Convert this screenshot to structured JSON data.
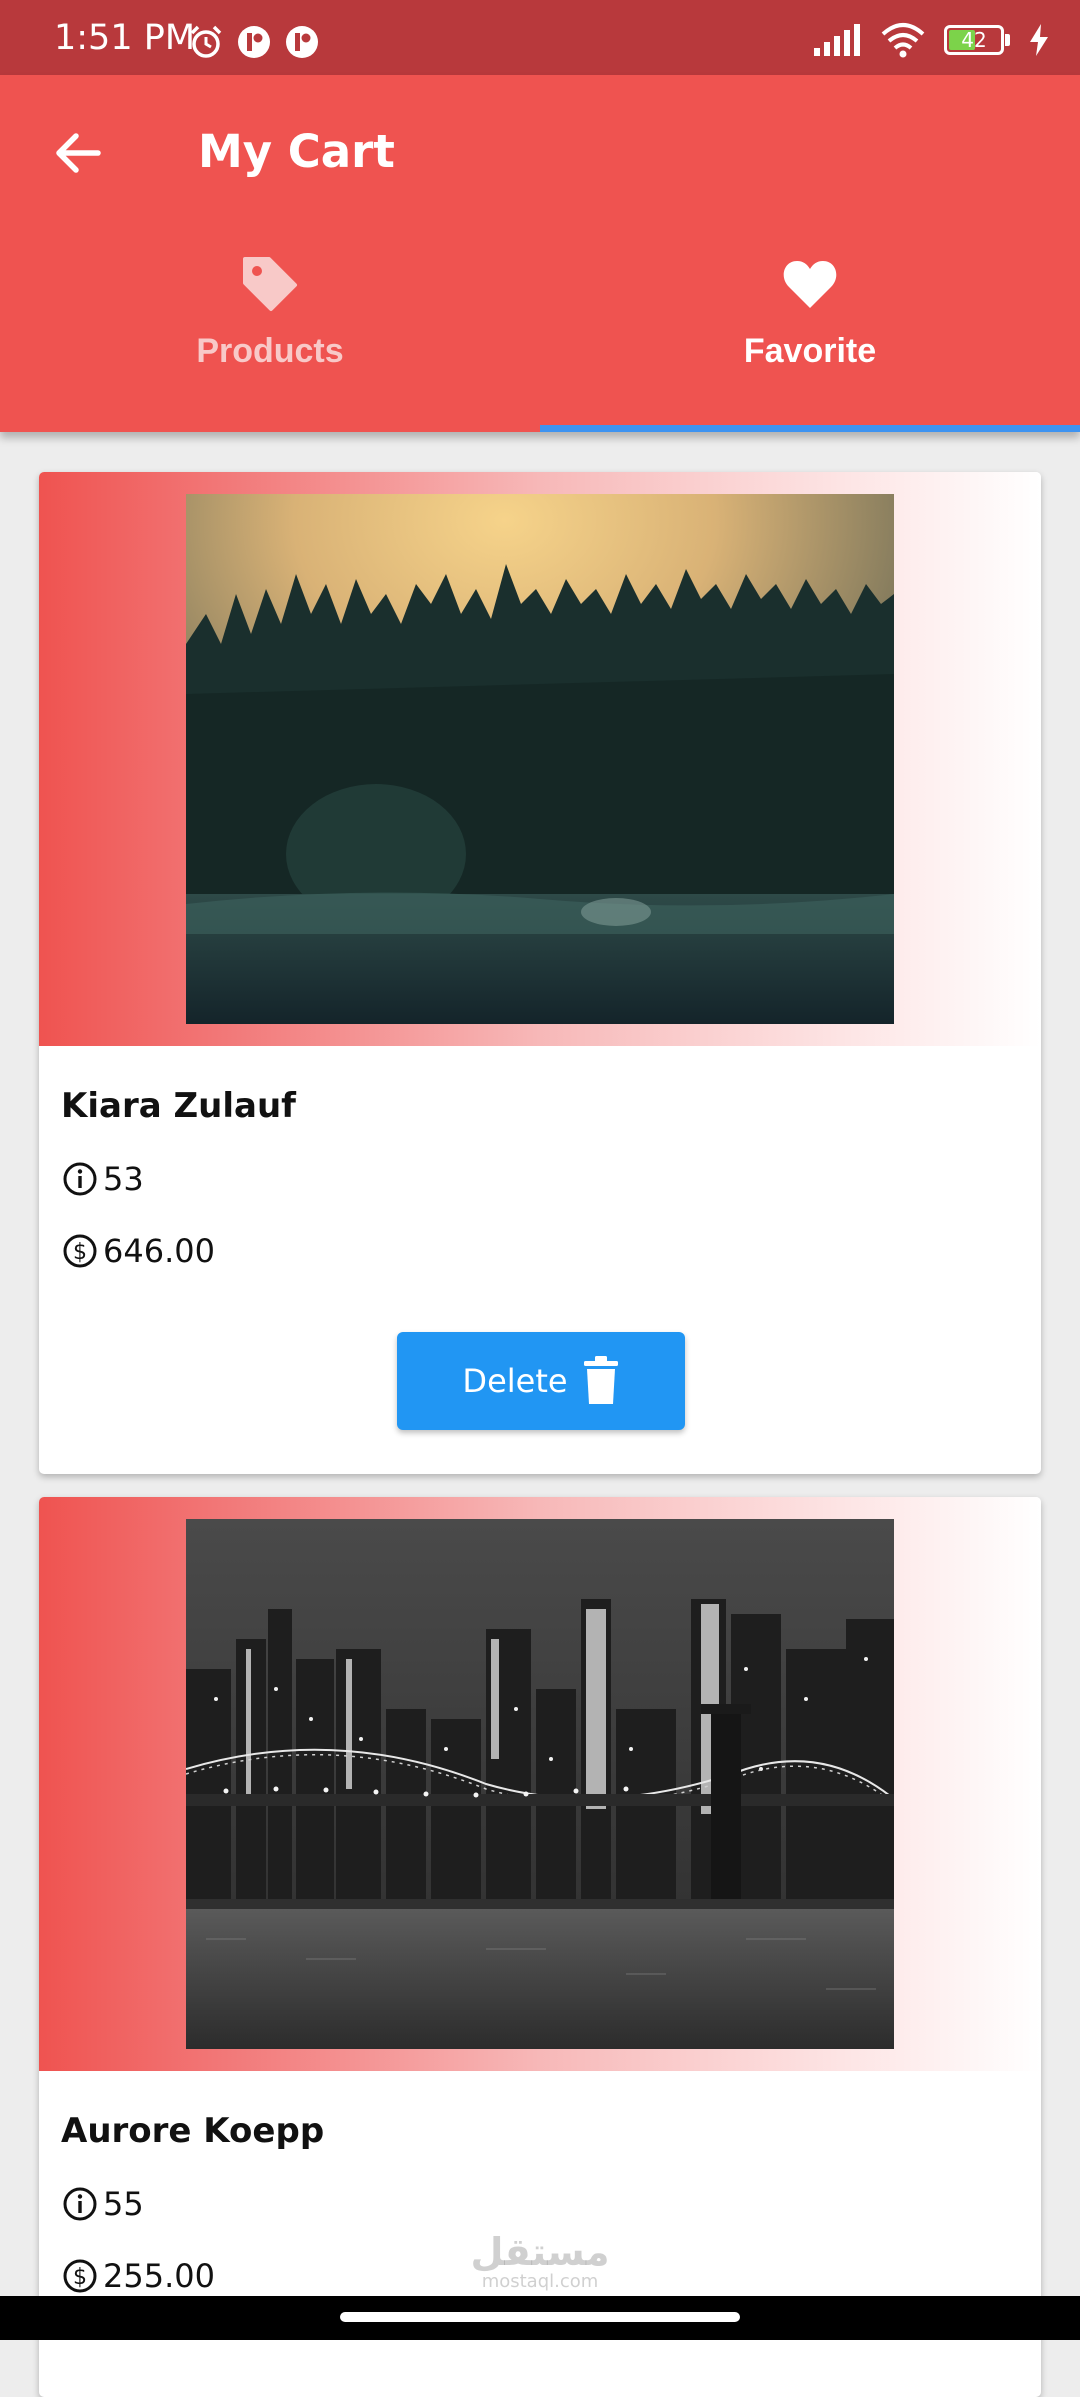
{
  "status_bar": {
    "time": "1:51 PM",
    "battery": "42",
    "icons": [
      "alarm-icon",
      "app-notification-icon",
      "app-notification-icon",
      "signal-icon",
      "wifi-icon",
      "battery-icon",
      "charging-icon"
    ]
  },
  "app_bar": {
    "title": "My Cart",
    "back_icon": "arrow-left-icon"
  },
  "tabs": [
    {
      "label": "Products",
      "icon": "tag-icon",
      "selected": false
    },
    {
      "label": "Favorite",
      "icon": "heart-icon",
      "selected": true
    }
  ],
  "colors": {
    "primary": "#ef5350",
    "status_bar": "#b8393c",
    "indicator": "#3d93f1",
    "button": "#2196f3"
  },
  "cards": [
    {
      "name": "Kiara Zulauf",
      "quantity": "53",
      "price": "646.00",
      "image": "forest at sunset",
      "delete_label": "Delete"
    },
    {
      "name": "Aurore Koepp",
      "quantity": "55",
      "price": "255.00",
      "image": "city skyline with bridge at night"
    }
  ],
  "watermark": {
    "arabic": "مستقل",
    "latin": "mostaql.com"
  }
}
